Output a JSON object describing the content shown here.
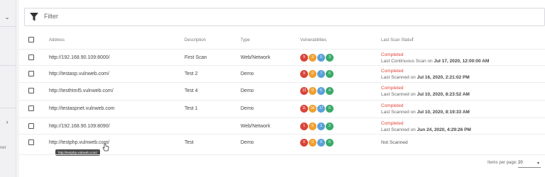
{
  "sidebar": {
    "partial_text": "ner"
  },
  "filter": {
    "label": "Filter"
  },
  "columns": {
    "address": "Address",
    "description": "Description",
    "type": "Type",
    "vulnerabilities": "Vulnerabilities",
    "last_scan_status": "Last Scan Status",
    "sort_icon": "arrow-up"
  },
  "rows": [
    {
      "address": "http://192.168.90.109:8000/",
      "description": "First Scan",
      "type": "Web/Network",
      "vulns": [
        "9",
        "3",
        "0",
        "3"
      ],
      "status": "Completed",
      "when_prefix": "Last Continuous Scan on",
      "when": "Jul 17, 2020, 12:00:00 AM"
    },
    {
      "address": "http://testasp.vulnweb.com/",
      "description": "Test 2",
      "type": "Demo",
      "vulns": [
        "9",
        "0",
        "7",
        "6"
      ],
      "status": "Completed",
      "when_prefix": "Last Scanned on",
      "when": "Jul 16, 2020, 2:21:02 PM"
    },
    {
      "address": "http://testhtml5.vulnweb.com/",
      "description": "Test 4",
      "type": "Demo",
      "vulns": [
        "13",
        "0",
        "5",
        "4"
      ],
      "status": "Completed",
      "when_prefix": "Last Scanned on",
      "when": "Jul 10, 2020, 8:23:52 AM"
    },
    {
      "address": "http://testaspnet.vulnweb.com",
      "description": "Test 1",
      "type": "Demo",
      "vulns": [
        "11",
        "16",
        "17",
        "6"
      ],
      "status": "Completed",
      "when_prefix": "Last Scanned on",
      "when": "Jul 10, 2020, 8:19:33 AM"
    },
    {
      "address": "http://192.168.90.109:8090/",
      "description": "",
      "type": "Web/Network",
      "vulns": [
        "1",
        "5",
        "1",
        "2"
      ],
      "status": "Completed",
      "when_prefix": "Last Scanned on",
      "when": "Jun 24, 2020, 4:29:26 PM"
    },
    {
      "address": "http://testphp.vulnweb.com/",
      "description": "Test",
      "type": "Demo",
      "vulns": [
        "0",
        "0",
        "0",
        "0"
      ],
      "status": "Not Scanned",
      "when_prefix": "",
      "when": ""
    }
  ],
  "tooltip": {
    "text": "http://testphp.vulnweb.com/"
  },
  "pagination": {
    "items_per_page_label": "Items per page:",
    "items_per_page_value": "20"
  },
  "colors": {
    "critical": "#d9443a",
    "high": "#f0a030",
    "medium": "#5aa0d8",
    "low": "#3aaa6a",
    "status_completed": "#e0453a"
  }
}
